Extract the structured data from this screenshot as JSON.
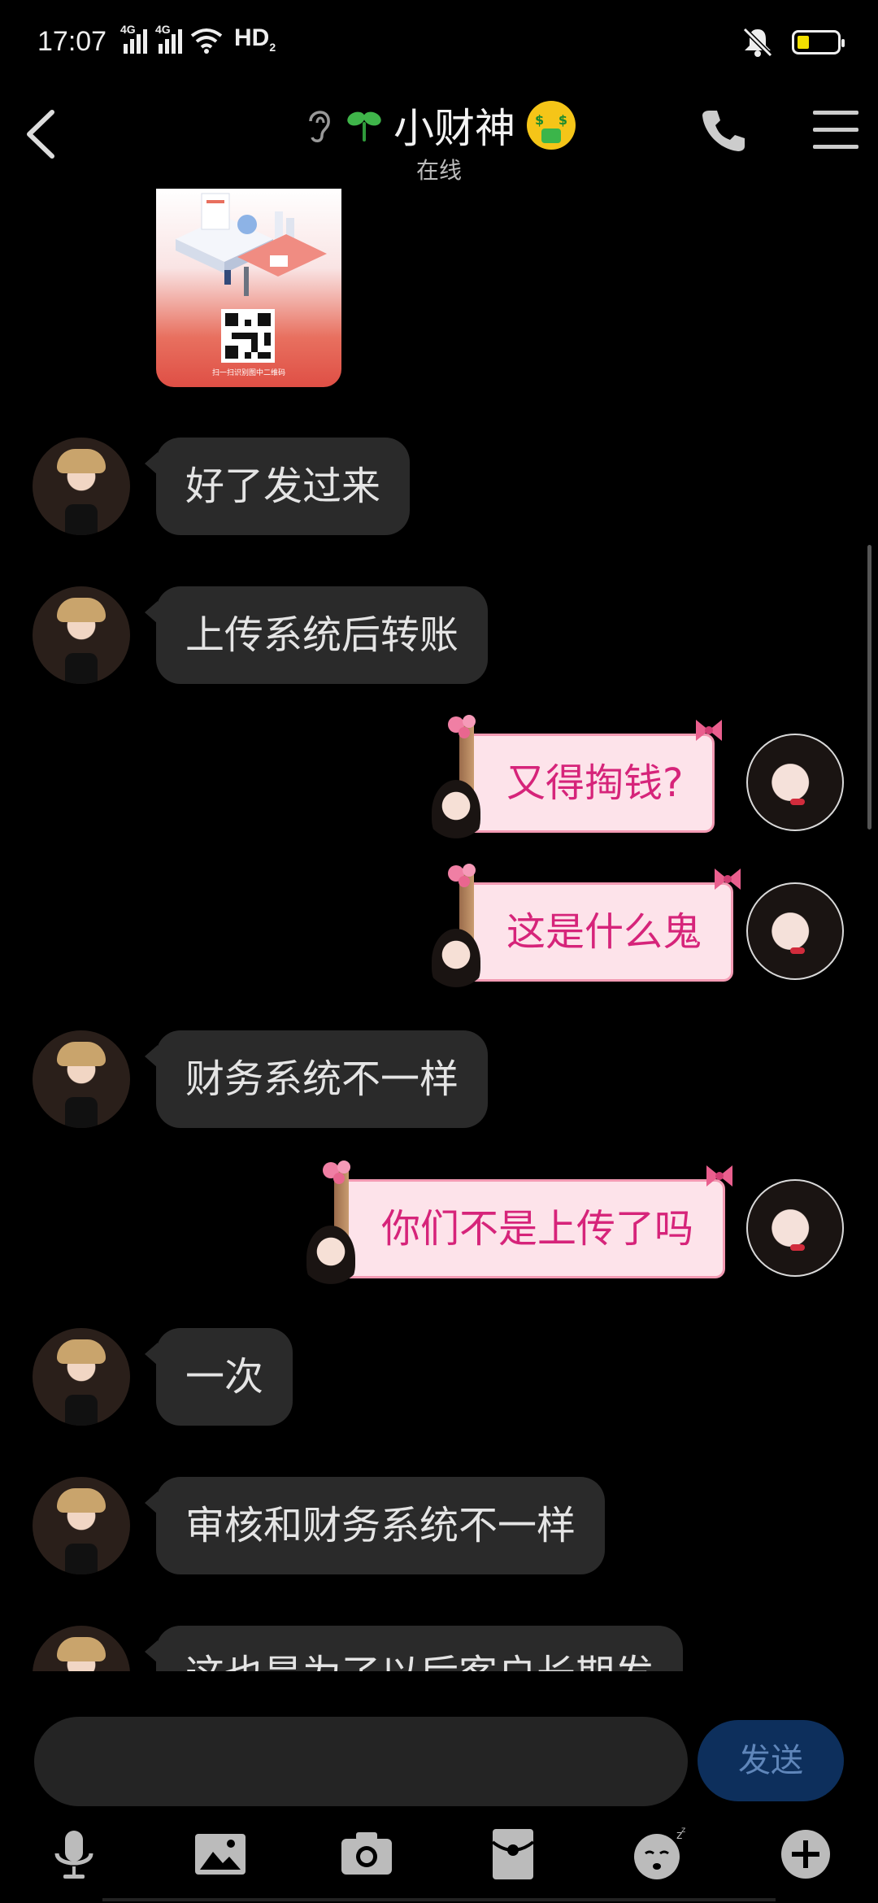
{
  "status_bar": {
    "time": "17:07",
    "net1": "4G",
    "net2": "4G",
    "hd": "HD",
    "hd_sub": "2"
  },
  "header": {
    "title": "小财神",
    "subtitle": "在线"
  },
  "qr_image": {
    "caption": "扫一扫识别图中二维码"
  },
  "messages": [
    {
      "side": "left",
      "text": "好了发过来"
    },
    {
      "side": "left",
      "text": "上传系统后转账"
    },
    {
      "side": "right",
      "text": "又得掏钱?"
    },
    {
      "side": "right",
      "text": "这是什么鬼"
    },
    {
      "side": "left",
      "text": "财务系统不一样"
    },
    {
      "side": "right",
      "text": "你们不是上传了吗"
    },
    {
      "side": "left",
      "text": "一次"
    },
    {
      "side": "left",
      "text": "审核和财务系统不一样"
    },
    {
      "side": "left",
      "text": "这也是为了以后客户长期发"
    }
  ],
  "input_bar": {
    "send_label": "发送"
  },
  "toolbar": {
    "icons": [
      "microphone-icon",
      "image-icon",
      "camera-icon",
      "red-packet-icon",
      "emoji-icon",
      "plus-icon"
    ]
  }
}
